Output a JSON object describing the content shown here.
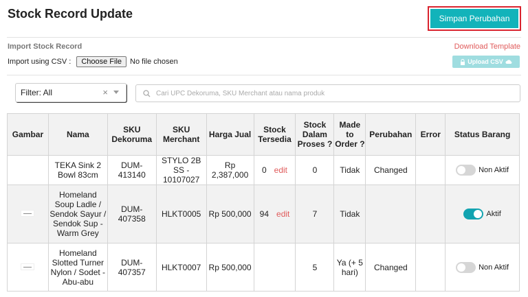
{
  "header": {
    "title": "Stock Record Update",
    "save_label": "Simpan Perubahan"
  },
  "import": {
    "title": "Import Stock Record",
    "label": "Import using CSV :",
    "choose_file": "Choose File",
    "no_file": "No file chosen",
    "download_link": "Download Template",
    "upload_label": "Upload CSV"
  },
  "filter": {
    "value": "Filter: All",
    "clear": "×"
  },
  "search": {
    "placeholder": "Cari UPC Dekoruma, SKU Merchant atau nama produk"
  },
  "table": {
    "headers": {
      "gambar": "Gambar",
      "nama": "Nama",
      "sku_dekoruma": "SKU Dekoruma",
      "sku_merchant": "SKU Merchant",
      "harga": "Harga Jual",
      "stock": "Stock Tersedia",
      "proses": "Stock Dalam Proses ?",
      "made": "Made to Order ?",
      "perubahan": "Perubahan",
      "error": "Error",
      "status": "Status Barang"
    },
    "edit_label": "edit",
    "rows": [
      {
        "nama": "TEKA Sink 2 Bowl 83cm",
        "sku_dekoruma": "DUM-413140",
        "sku_merchant": "STYLO 2B SS - 10107027",
        "harga": "Rp 2,387,000",
        "stock": "0",
        "proses": "0",
        "made": "Tidak",
        "perubahan": "Changed",
        "error": "",
        "status": "Non Aktif"
      },
      {
        "nama": "Homeland Soup Ladle / Sendok Sayur / Sendok Sup - Warm Grey",
        "sku_dekoruma": "DUM-407358",
        "sku_merchant": "HLKT0005",
        "harga": "Rp 500,000",
        "stock": "94",
        "proses": "7",
        "made": "Tidak",
        "perubahan": "",
        "error": "",
        "status": "Aktif"
      },
      {
        "nama": "Homeland Slotted Turner Nylon / Sodet - Abu-abu",
        "sku_dekoruma": "DUM-407357",
        "sku_merchant": "HLKT0007",
        "harga": "Rp 500,000",
        "stock": "",
        "proses": "5",
        "made": "Ya (+ 5 hari)",
        "perubahan": "Changed",
        "error": "",
        "status": "Non Aktif"
      }
    ]
  },
  "colors": {
    "accent": "#12b3ba",
    "highlight_border": "#d9232e",
    "link": "#e05a5a"
  }
}
